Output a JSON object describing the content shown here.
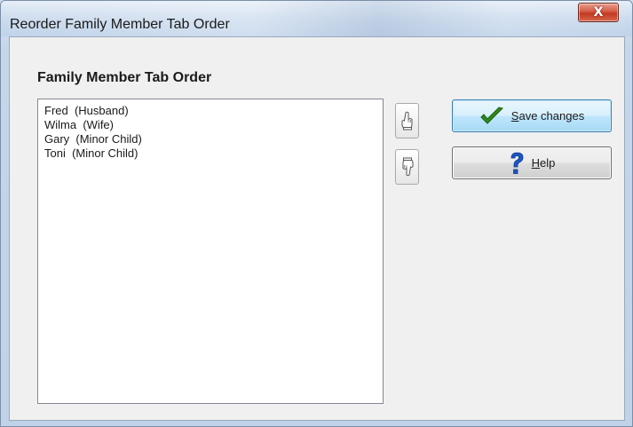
{
  "window": {
    "title": "Reorder Family Member Tab Order",
    "close_glyph": "X"
  },
  "group": {
    "title": "Family Member Tab Order"
  },
  "members": [
    "Fred  (Husband)",
    "Wilma  (Wife)",
    "Gary  (Minor Child)",
    "Toni  (Minor Child)"
  ],
  "buttons": {
    "move_up_icon": "pointing-hand-up-icon",
    "move_down_icon": "pointing-hand-down-icon",
    "save": {
      "mnemonic": "S",
      "rest": "ave changes",
      "icon": "checkmark-icon",
      "icon_color": "#2f8a1e"
    },
    "help": {
      "mnemonic": "H",
      "rest": "elp",
      "icon": "question-mark-icon",
      "icon_color": "#1b56c4"
    }
  }
}
